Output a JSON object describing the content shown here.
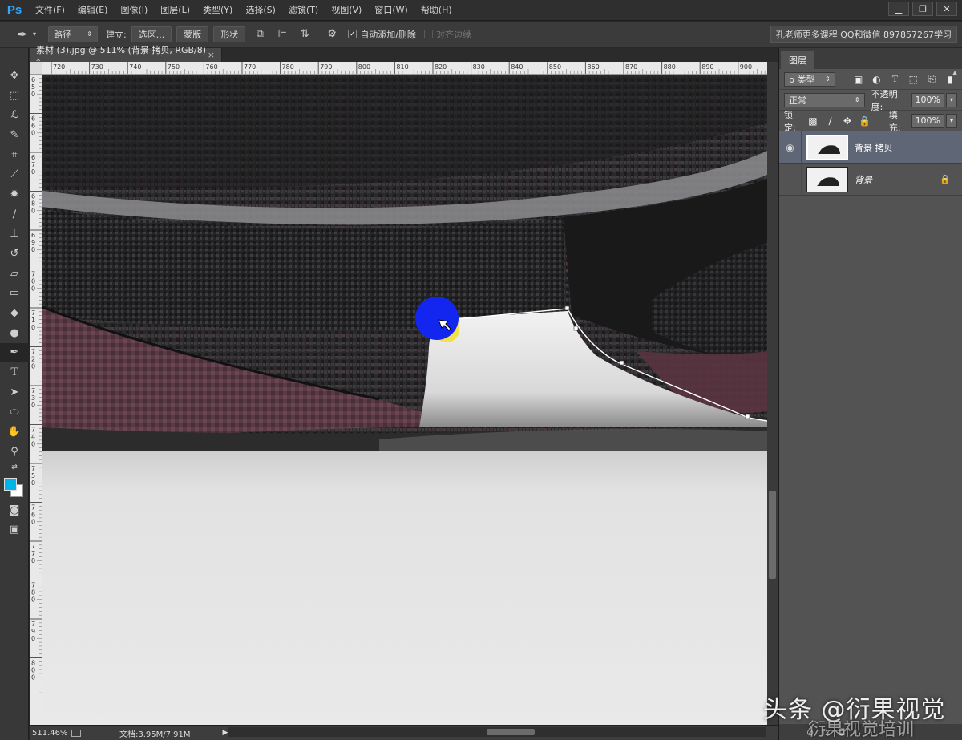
{
  "app": {
    "logo": "Ps"
  },
  "menu": [
    "文件(F)",
    "编辑(E)",
    "图像(I)",
    "图层(L)",
    "类型(Y)",
    "选择(S)",
    "滤镜(T)",
    "视图(V)",
    "窗口(W)",
    "帮助(H)"
  ],
  "window_controls": {
    "minimize": "▁",
    "restore": "❐",
    "close": "✕"
  },
  "options": {
    "mode": "路径",
    "make_label": "建立:",
    "selection_btn": "选区...",
    "mask_btn": "蒙版",
    "shape_btn": "形状",
    "auto_add_delete": "自动添加/删除",
    "auto_add_checked": true,
    "align_edges": "对齐边缘",
    "align_edges_checked": false,
    "workspace": "孔老师更多课程 QQ和微信 897857267学习"
  },
  "document": {
    "tab_title": "素材 (3).jpg @ 511% (背景 拷贝, RGB/8) *",
    "ruler_h_labels": [
      "720",
      "730",
      "740",
      "750",
      "760",
      "770",
      "780",
      "790",
      "800",
      "810",
      "820",
      "830",
      "840",
      "850",
      "860",
      "870",
      "880",
      "890",
      "900"
    ],
    "ruler_v_labels": [
      "6",
      "5",
      "0",
      "6",
      "6",
      "0",
      "6",
      "7",
      "0",
      "6",
      "8",
      "0",
      "6",
      "9",
      "0",
      "7",
      "0",
      "0",
      "7",
      "1",
      "0",
      "7",
      "2",
      "0",
      "7",
      "3",
      "0",
      "7",
      "4",
      "0",
      "7",
      "5",
      "0",
      "7",
      "6",
      "0",
      "7",
      "7",
      "0",
      "7",
      "8",
      "0",
      "7",
      "9",
      "0",
      "8",
      "0",
      "0"
    ]
  },
  "status": {
    "zoom": "511.46%",
    "doc_info": "文档:3.95M/7.91M"
  },
  "colors": {
    "foreground": "#00b4ea",
    "background": "#ffffff",
    "accent": "#31a8ff"
  },
  "tools": [
    "move-icon",
    "marquee-icon",
    "lasso-icon",
    "quick-select-icon",
    "crop-icon",
    "eyedropper-icon",
    "healing-icon",
    "brush-icon",
    "stamp-icon",
    "history-brush-icon",
    "eraser-icon",
    "gradient-icon",
    "blur-icon",
    "dodge-icon",
    "pen-icon",
    "type-icon",
    "path-select-icon",
    "ellipse-icon",
    "hand-icon",
    "zoom-icon"
  ],
  "layers_panel": {
    "tab": "图层",
    "filter_kind": "ρ 类型",
    "blend_mode": "正常",
    "opacity_label": "不透明度:",
    "opacity": "100%",
    "lock_label": "锁定:",
    "fill_label": "填充:",
    "fill": "100%",
    "layers": [
      {
        "name": "背景 拷贝",
        "visible": true,
        "selected": true,
        "locked": false
      },
      {
        "name": "背景",
        "visible": false,
        "selected": false,
        "locked": true
      }
    ]
  },
  "watermark": {
    "main": "头条 @衍果视觉",
    "sub": "衍果视觉培训"
  }
}
